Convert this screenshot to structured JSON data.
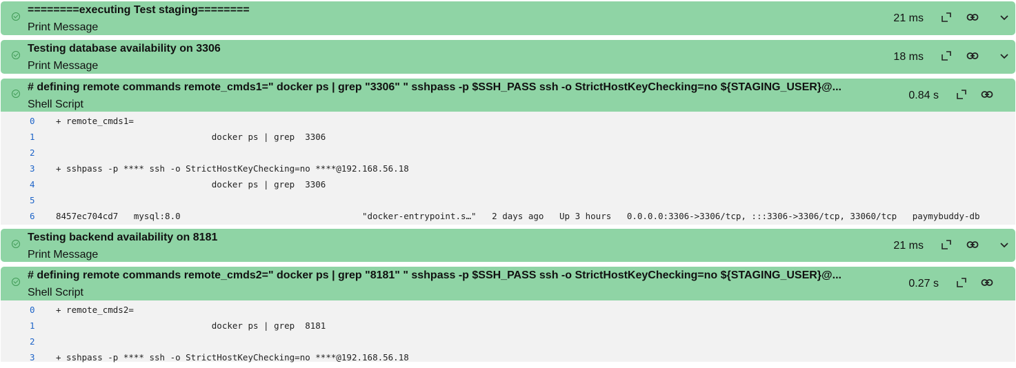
{
  "steps": [
    {
      "title": "========executing Test staging========",
      "type": "Print Message",
      "duration": "21 ms"
    },
    {
      "title": "Testing database availability on 3306",
      "type": "Print Message",
      "duration": "18 ms"
    },
    {
      "title": "# defining remote commands remote_cmds1=\" docker ps | grep \"3306\" \" sshpass -p $SSH_PASS ssh -o StrictHostKeyChecking=no ${STAGING_USER}@...",
      "type": "Shell Script",
      "duration": "0.84 s"
    },
    {
      "title": "Testing backend availability on 8181",
      "type": "Print Message",
      "duration": "21 ms"
    },
    {
      "title": "# defining remote commands remote_cmds2=\" docker ps | grep \"8181\" \" sshpass -p $SSH_PASS ssh -o StrictHostKeyChecking=no ${STAGING_USER}@...",
      "type": "Shell Script",
      "duration": "0.27 s"
    }
  ],
  "log1": [
    {
      "n": "0",
      "t": "+ remote_cmds1="
    },
    {
      "n": "1",
      "t": "                              docker ps | grep  3306"
    },
    {
      "n": "2",
      "t": ""
    },
    {
      "n": "3",
      "t": "+ sshpass -p **** ssh -o StrictHostKeyChecking=no ****@192.168.56.18"
    },
    {
      "n": "4",
      "t": "                              docker ps | grep  3306"
    },
    {
      "n": "5",
      "t": ""
    },
    {
      "n": "6",
      "t": "8457ec704cd7   mysql:8.0                                   \"docker-entrypoint.s…\"   2 days ago   Up 3 hours   0.0.0.0:3306->3306/tcp, :::3306->3306/tcp, 33060/tcp   paymybuddy-db"
    }
  ],
  "log2": [
    {
      "n": "0",
      "t": "+ remote_cmds2="
    },
    {
      "n": "1",
      "t": "                              docker ps | grep  8181"
    },
    {
      "n": "2",
      "t": ""
    },
    {
      "n": "3",
      "t": "+ sshpass -p **** ssh -o StrictHostKeyChecking=no ****@192.168.56.18"
    }
  ],
  "icons": {
    "status": "check-circle-icon",
    "open": "open-external-icon",
    "link": "link-icon",
    "expand": "chevron-down-icon"
  },
  "colors": {
    "success_bg": "#8fd4a5",
    "log_bg": "#f2f2f2",
    "line_number": "#1e64c8"
  }
}
